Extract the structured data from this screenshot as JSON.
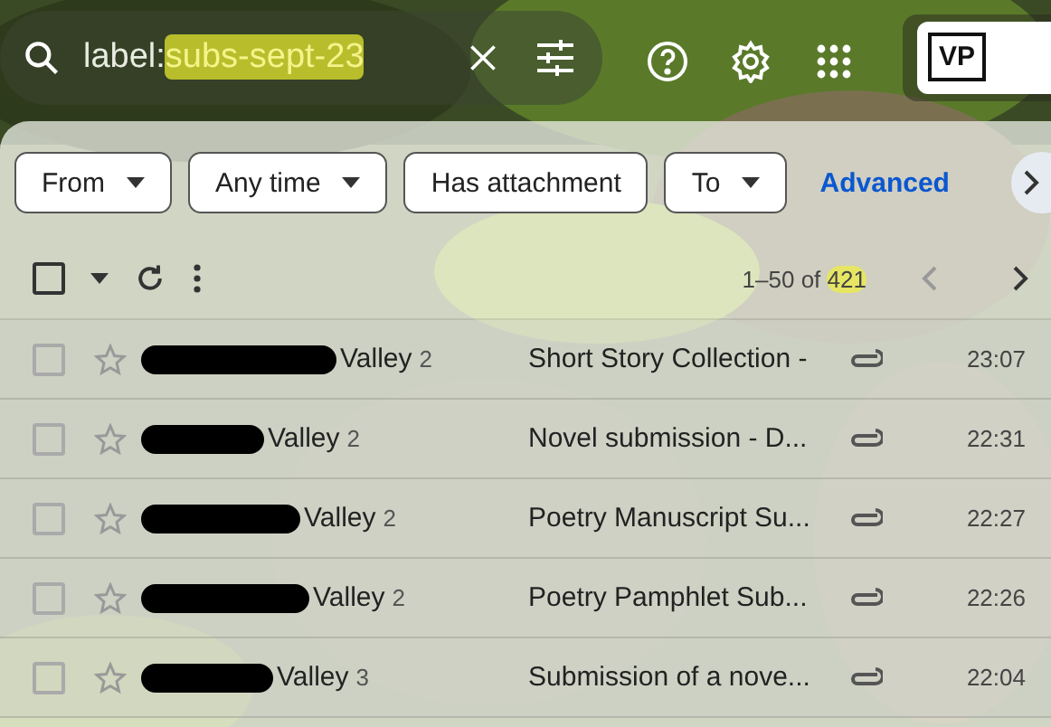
{
  "search": {
    "prefix": "label:",
    "highlighted": "subs-sept-23"
  },
  "account": {
    "initials": "VP"
  },
  "filters": [
    {
      "label": "From",
      "dropdown": true
    },
    {
      "label": "Any time",
      "dropdown": true
    },
    {
      "label": "Has attachment",
      "dropdown": false
    },
    {
      "label": "To",
      "dropdown": true
    }
  ],
  "advanced_link": "Advanced",
  "select_all": {
    "checked": false
  },
  "pagination": {
    "range": "1–50 of ",
    "total": "421"
  },
  "emails": [
    {
      "sender": "Valley",
      "count": "2",
      "subject": "Short Story Collection -",
      "time": "23:07",
      "attachment": true,
      "starred": false,
      "checked": false
    },
    {
      "sender": "Valley",
      "count": "2",
      "subject": "Novel submission - D...",
      "time": "22:31",
      "attachment": true,
      "starred": false,
      "checked": false
    },
    {
      "sender": "Valley",
      "count": "2",
      "subject": "Poetry Manuscript Su...",
      "time": "22:27",
      "attachment": true,
      "starred": false,
      "checked": false
    },
    {
      "sender": "Valley",
      "count": "2",
      "subject": "Poetry Pamphlet Sub...",
      "time": "22:26",
      "attachment": true,
      "starred": false,
      "checked": false
    },
    {
      "sender": "Valley",
      "count": "3",
      "subject": "Submission of a nove...",
      "time": "22:04",
      "attachment": true,
      "starred": false,
      "checked": false
    }
  ]
}
